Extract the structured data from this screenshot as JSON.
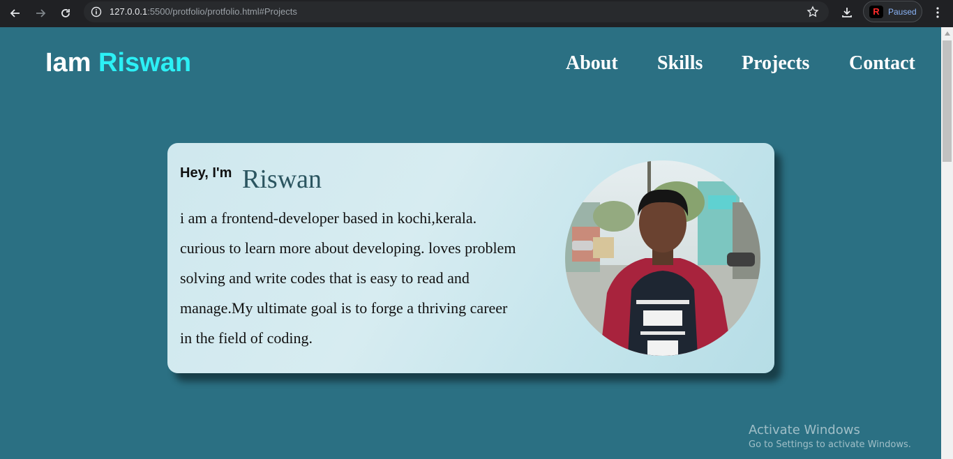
{
  "browser": {
    "url_host": "127.0.0.1",
    "url_rest": ":5500/protfolio/protfolio.html#Projects",
    "profile_initial": "R",
    "profile_status": "Paused"
  },
  "header": {
    "logo_prefix": "Iam",
    "logo_name": "Riswan",
    "nav": [
      "About",
      "Skills",
      "Projects",
      "Contact"
    ]
  },
  "hero": {
    "greeting": "Hey, I'm",
    "name": "Riswan",
    "bio_lines": [
      "i am a frontend-developer based in kochi,kerala.",
      "curious to learn more about developing. loves problem",
      "solving and write codes that is easy to read and",
      "manage.My ultimate goal is to forge a thriving career",
      "in the field of coding."
    ],
    "photo_icon": "profile-photo"
  },
  "watermark": {
    "title": "Activate Windows",
    "subtitle": "Go to Settings to activate Windows."
  },
  "colors": {
    "page_bg": "#2b7083",
    "logo_accent": "#2cf0f5",
    "chrome_bg": "#202124"
  }
}
